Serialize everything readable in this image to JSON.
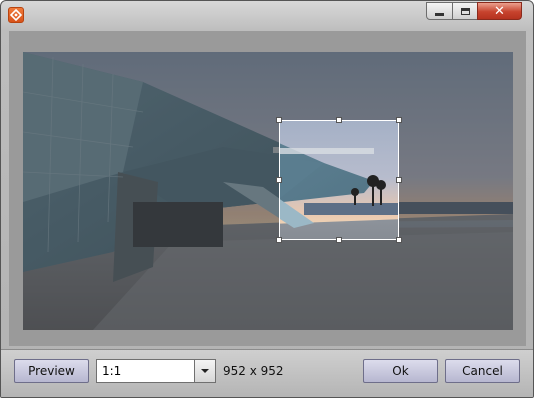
{
  "titlebar": {
    "icon": "app-logo-icon",
    "buttons": [
      "minimize-icon",
      "maximize-icon",
      "close-icon"
    ],
    "close_glyph": "✕"
  },
  "image": {
    "description_icon": "photo-preview"
  },
  "crop": {
    "aspect": "1:1"
  },
  "bottom": {
    "preview_label": "Preview",
    "ratio_value": "1:1",
    "dimensions": "952 x 952",
    "ok_label": "Ok",
    "cancel_label": "Cancel"
  },
  "colors": {
    "accent": "#e0622a",
    "button_top": "#dcdcec",
    "button_bottom": "#b7b7d0"
  }
}
